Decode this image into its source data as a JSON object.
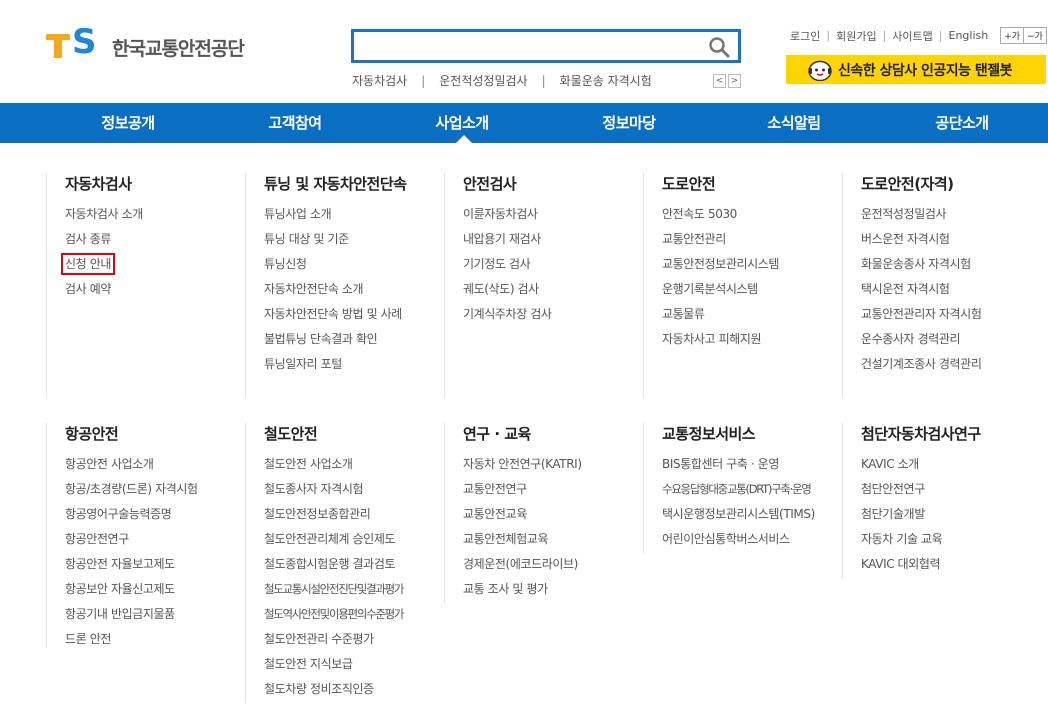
{
  "logo": {
    "mark": "TS",
    "name": "한국교통안전공단"
  },
  "search": {
    "value": "",
    "placeholder": ""
  },
  "keywords": [
    "자동차검사",
    "운전적성정밀검사",
    "화물운송 자격시험"
  ],
  "keyword_nav": {
    "prev": "<",
    "next": ">"
  },
  "util_links": [
    "로그인",
    "회원가입",
    "사이트맵",
    "English"
  ],
  "font_size": {
    "increase": "+가",
    "decrease": "−가"
  },
  "chatbot": {
    "label": "신속한 상담사 인공지능 탠젤봇"
  },
  "gnb": [
    "정보공개",
    "고객참여",
    "사업소개",
    "정보마당",
    "소식알림",
    "공단소개"
  ],
  "sitemap": {
    "row1": [
      {
        "title": "자동차검사",
        "items": [
          "자동차검사 소개",
          "검사 종류",
          "신청 안내",
          "검사 예약"
        ]
      },
      {
        "title": "튜닝 및 자동차안전단속",
        "items": [
          "튜닝사업 소개",
          "튜닝 대상 및 기준",
          "튜닝신청",
          "자동차안전단속 소개",
          "자동차안전단속 방법 및 사례",
          "불법튜닝 단속결과 확인",
          "튜닝일자리 포털"
        ]
      },
      {
        "title": "안전검사",
        "items": [
          "이륜자동차검사",
          "내압용기 재검사",
          "기기정도 검사",
          "궤도(삭도) 검사",
          "기계식주차장 검사"
        ]
      },
      {
        "title": "도로안전",
        "items": [
          "안전속도 5030",
          "교통안전관리",
          "교통안전정보관리시스템",
          "운행기록분석시스템",
          "교통물류",
          "자동차사고 피해지원"
        ]
      },
      {
        "title": "도로안전(자격)",
        "items": [
          "운전적성정밀검사",
          "버스운전 자격시험",
          "화물운송종사 자격시험",
          "택시운전 자격시험",
          "교통안전관리자 자격시험",
          "운수종사자 경력관리",
          "건설기계조종사 경력관리"
        ]
      }
    ],
    "row2": [
      {
        "title": "항공안전",
        "items": [
          "항공안전 사업소개",
          "항공/초경량(드론) 자격시험",
          "항공영어구술능력증명",
          "항공안전연구",
          "항공안전 자율보고제도",
          "항공보안 자율신고제도",
          "항공기내 반입금지물품",
          "드론 안전"
        ]
      },
      {
        "title": "철도안전",
        "items": [
          "철도안전 사업소개",
          "철도종사자 자격시험",
          "철도안전정보종합관리",
          "철도안전관리체계 승인제도",
          "철도종합시험운행 결과검토",
          "철도교통시설안전진단및결과평가",
          "철도역사안전및이용편의수준평가",
          "철도안전관리 수준평가",
          "철도안전 지식보급",
          "철도차량 정비조직인증"
        ]
      },
      {
        "title": "연구 · 교육",
        "items": [
          "자동차 안전연구(KATRI)",
          "교통안전연구",
          "교통안전교육",
          "교통안전체험교육",
          "경제운전(에코드라이브)",
          "교통 조사 및 평가"
        ]
      },
      {
        "title": "교통정보서비스",
        "items": [
          "BIS통합센터 구축 · 운영",
          "수요응답형대중교통(DRT)구축·운영",
          "택시운행정보관리시스템(TIMS)",
          "어린이안심통학버스서비스"
        ]
      },
      {
        "title": "첨단자동차검사연구",
        "items": [
          "KAVIC 소개",
          "첨단안전연구",
          "첨단기술개발",
          "자동차 기술 교육",
          "KAVIC 대외협력"
        ]
      }
    ]
  },
  "colors": {
    "brand_blue": "#0a6fc2",
    "logo_orange": "#f5a81c",
    "chatbot_yellow": "#ffd400",
    "highlight_red": "#e0001a"
  },
  "highlighted_item": "신청 안내"
}
